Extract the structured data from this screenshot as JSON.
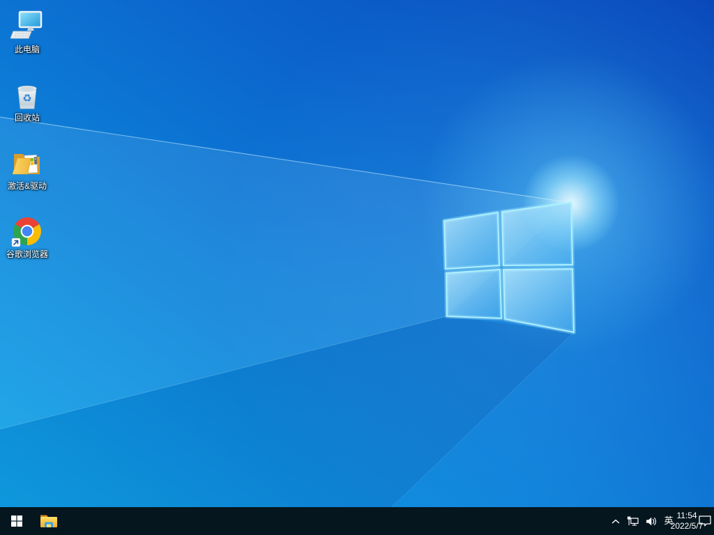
{
  "wallpaper": {
    "name": "Windows 10 默认壁纸",
    "logo_icon": "windows-logo"
  },
  "desktop": {
    "icons": [
      {
        "icon": "this-pc-icon",
        "label": "此电脑"
      },
      {
        "icon": "recycle-bin-icon",
        "label": "回收站"
      },
      {
        "icon": "activation-drivers-folder-icon",
        "label": "激活&驱动"
      },
      {
        "icon": "google-chrome-icon",
        "label": "谷歌浏览器"
      }
    ]
  },
  "taskbar": {
    "start": {
      "icon": "start-icon"
    },
    "pinned": [
      {
        "icon": "file-explorer-icon"
      }
    ],
    "tray": {
      "hidden_icons": {
        "icon": "chevron-up-icon"
      },
      "network": {
        "icon": "ethernet-icon"
      },
      "volume": {
        "icon": "speaker-icon"
      },
      "ime": {
        "label": "英"
      },
      "clock": {
        "time": "11:54",
        "date": "2022/5/7"
      },
      "action_center": {
        "icon": "action-center-icon"
      }
    }
  },
  "colors": {
    "taskbar_bg": "#05161f",
    "wallpaper_dark": "#0a48ba",
    "wallpaper_mid": "#0d7fd8",
    "wallpaper_light": "#0fa5e9",
    "logo_stroke": "#aef0ff",
    "chrome_red": "#ea4335",
    "chrome_yellow": "#fbbc05",
    "chrome_green": "#2da44e",
    "chrome_blue": "#4285f4",
    "folder_yellow": "#fccf3e",
    "recycle_arrow_blue": "#2f80d0"
  }
}
